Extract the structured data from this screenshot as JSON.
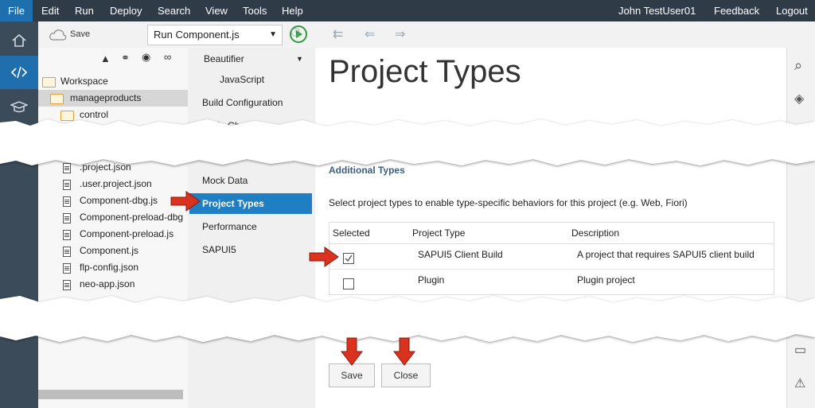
{
  "menubar": {
    "file": "File",
    "edit": "Edit",
    "run": "Run",
    "deploy": "Deploy",
    "search": "Search",
    "view": "View",
    "tools": "Tools",
    "help": "Help",
    "user": "John TestUser01",
    "feedback": "Feedback",
    "logout": "Logout"
  },
  "toolbar": {
    "save": "Save",
    "run_config": "Run Component.js"
  },
  "workspace": {
    "root": "Workspace",
    "project": "manageproducts",
    "folder_control": "control",
    "files": [
      ".project.json",
      ".user.project.json",
      "Component-dbg.js",
      "Component-preload-dbg",
      "Component-preload.js",
      "Component.js",
      "flp-config.json",
      "neo-app.json"
    ]
  },
  "nav": {
    "beautifier": "Beautifier",
    "javascript": "JavaScript",
    "build_config": "Build Configuration",
    "code_checking": "Code Checking",
    "mock_data": "Mock Data",
    "project_types": "Project Types",
    "performance": "Performance",
    "sapui5": "SAPUI5"
  },
  "main": {
    "title": "Project Types",
    "section": "Additional Types",
    "instructions": "Select project types to enable type-specific behaviors for this project (e.g. Web, Fiori)",
    "columns": [
      "Selected",
      "Project Type",
      "Description"
    ],
    "rows": [
      {
        "type": "SAPUI5 Client Build",
        "description": "A project that requires SAPUI5 client build",
        "selected": true
      },
      {
        "type": "Plugin",
        "description": "Plugin project",
        "selected": false
      }
    ],
    "save": "Save",
    "close": "Close"
  },
  "colors": {
    "menubar": "#2f3c48",
    "accent": "#1f7fc2",
    "arrow": "#d9321e"
  }
}
